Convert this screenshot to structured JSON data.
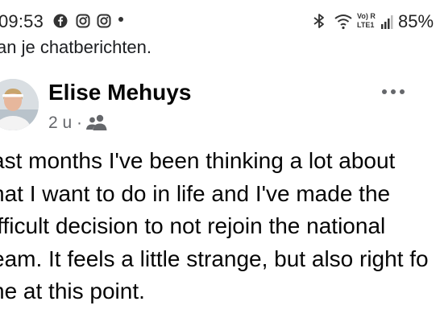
{
  "status_bar": {
    "time": "09:53",
    "app_icons": [
      "facebook-icon",
      "instagram-icon",
      "instagram-icon"
    ],
    "system_icons": [
      "bluetooth-icon",
      "wifi-icon",
      "volte-icon",
      "signal-icon"
    ],
    "network_label_top": "Vo) R",
    "network_label_bottom": "LTE1",
    "battery": "85%"
  },
  "notification": {
    "text": "an je chatberichten."
  },
  "post": {
    "author": "Elise Mehuys",
    "time_ago": "2 u ·",
    "audience_icon": "friends-icon",
    "lines": [
      "ast months I've been thinking a lot about",
      "hat I want to do in life and I've made the",
      "ifficult decision to not rejoin the national",
      "eam. It feels a little strange, but also right fo",
      "ne at this point."
    ]
  },
  "colors": {
    "text": "#050505",
    "secondary": "#65676b",
    "background": "#ffffff"
  }
}
